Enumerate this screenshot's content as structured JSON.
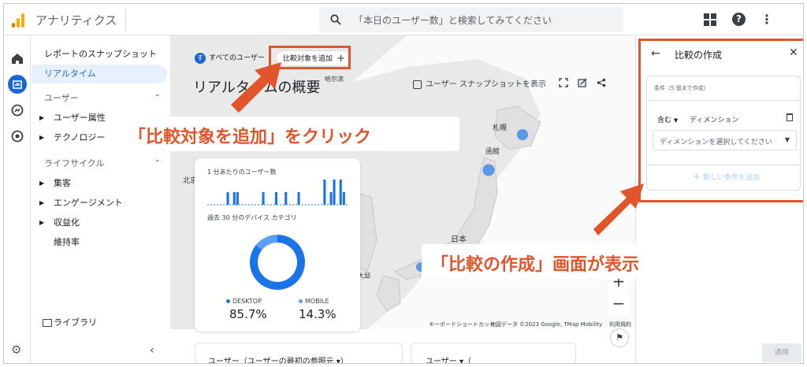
{
  "header": {
    "app_title": "アナリティクス",
    "search_placeholder": "「本日のユーザー数」と検索してみてください"
  },
  "nav": {
    "items": [
      {
        "label": "レポートのスナップショット"
      },
      {
        "label": "リアルタイム"
      },
      {
        "label": "ユーザー"
      },
      {
        "label": "ユーザー属性"
      },
      {
        "label": "テクノロジー"
      },
      {
        "label": "ライフサイクル"
      },
      {
        "label": "集客"
      },
      {
        "label": "エンゲージメント"
      },
      {
        "label": "収益化"
      },
      {
        "label": "維持率"
      }
    ],
    "library": "ライブラリ"
  },
  "main": {
    "chip_all_users": "すべてのユーザー",
    "chip_all_users_badge": "す",
    "chip_add_comparison": "比較対象を追加",
    "page_title": "リアルタイムの概要",
    "snapshot_button": "ユーザー スナップショットを表示",
    "card": {
      "users_per_min_label": "1 分あたりのユーザー数",
      "device_label": "過去 30 分のデバイス カテゴリ",
      "desktop_label": "DESKTOP",
      "desktop_value": "85.7%",
      "mobile_label": "MOBILE",
      "mobile_value": "14.3%"
    },
    "map_footer": {
      "shortcuts": "キーボードショートカット",
      "map_data": "地図データ ©2023 Google, TMap Mobility",
      "terms": "利用規約"
    },
    "map_labels": {
      "sapporo": "札幌",
      "hakodate": "函館",
      "japan": "日本",
      "beijing": "北京",
      "daegu": "大邱",
      "harbin": "哈尔滨"
    },
    "bottom_card1": "ユーザー（ユーザーの最初の参照元 ▾）",
    "bottom_card2": "ユーザー ▾（"
  },
  "annotations": {
    "callout_click": "「比較対象を追加」をクリック",
    "callout_shown": "「比較の作成」画面が表示",
    "color": "#e0552b"
  },
  "panel": {
    "title": "比較の作成",
    "conditions_label": "条件（5 個まで作成）",
    "include": "含む",
    "dimension": "ディメンション",
    "select_placeholder": "ディメンションを選択してください",
    "add_condition": "新しい条件を追加",
    "apply": "適用"
  },
  "chart_data": {
    "type": "bar",
    "title": "1 分あたりのユーザー数",
    "values": [
      0,
      0,
      0,
      0,
      0,
      0,
      1,
      0,
      1,
      1,
      0,
      0,
      0,
      0,
      0,
      0,
      0,
      1,
      0,
      0,
      0,
      1,
      0,
      0,
      1,
      0,
      0,
      0,
      1,
      0,
      0,
      0,
      0,
      0,
      0,
      0,
      2,
      0,
      1,
      2,
      0,
      2,
      1,
      0
    ],
    "donut": {
      "type": "pie",
      "categories": [
        "DESKTOP",
        "MOBILE"
      ],
      "values": [
        85.7,
        14.3
      ]
    }
  }
}
